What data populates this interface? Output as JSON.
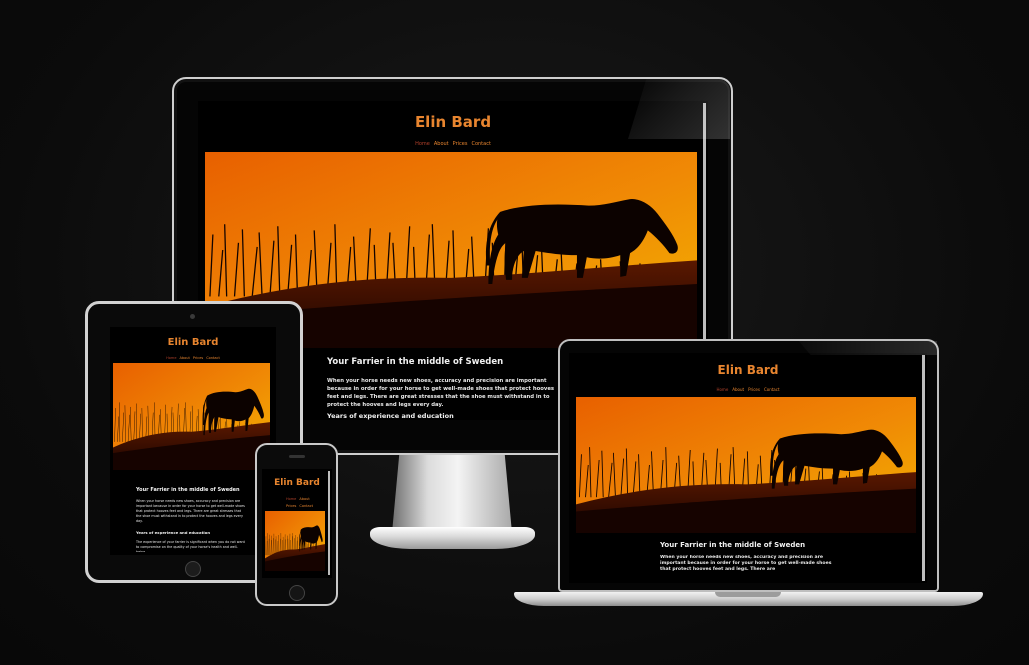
{
  "site": {
    "title": "Elin Bard",
    "nav": [
      "Home",
      "About",
      "Prices",
      "Contact"
    ],
    "heading": "Your Farrier in the middle of Sweden",
    "intro": "When your horse needs new shoes, accuracy and precision are important because in order for your horse to get well-made shoes that protect hooves feet and legs. There are great stresses that the shoe must withstand in to protect the hooves and legs every day.",
    "subheading": "Years of experience and education",
    "subtext": "The experience of your farrier is significant when you do not want to compromise on the quality of your horse's health and well-being."
  },
  "laptop": {
    "intro_partial": "When your horse needs new shoes, accuracy and precision are important because in order for your horse to get well-made shoes that protect hooves feet and legs. There are"
  },
  "colors": {
    "accent": "#e8852f",
    "nav_active": "#b0402a",
    "background": "#000000",
    "sunset_top": "#e86a00",
    "sunset_bottom": "#8a2400"
  },
  "devices": [
    "desktop-monitor",
    "tablet",
    "laptop",
    "phone"
  ]
}
